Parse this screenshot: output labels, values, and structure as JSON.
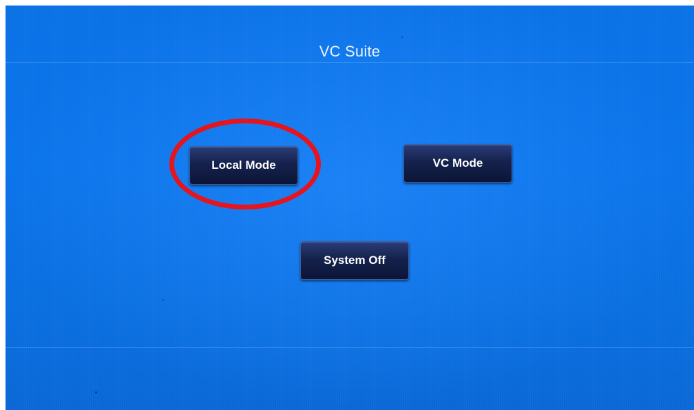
{
  "screen": {
    "title": "VC Suite"
  },
  "buttons": {
    "local_mode": "Local Mode",
    "vc_mode": "VC Mode",
    "system_off": "System Off"
  },
  "colors": {
    "background": "#0b74ea",
    "button": "#15224d",
    "highlight_circle": "#e5141d"
  }
}
